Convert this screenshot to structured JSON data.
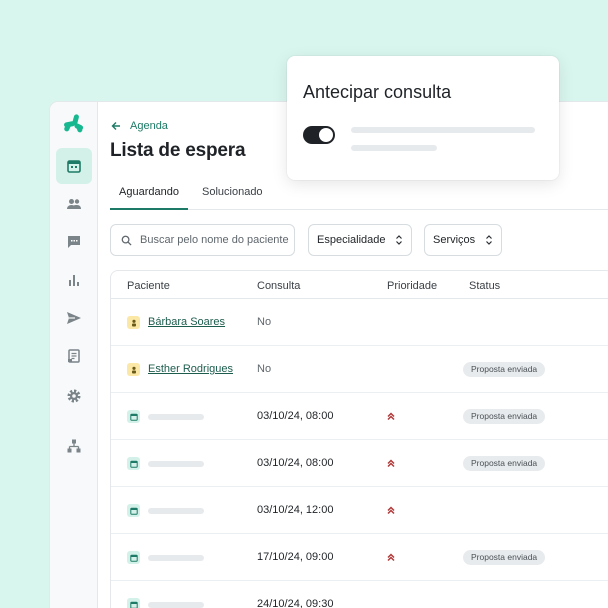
{
  "colors": {
    "accent": "#1d7a66",
    "background": "#d9f6ee",
    "priority": "#b23a3a"
  },
  "sidebar": {
    "logo_icon": "doctoralia-logo-icon",
    "items": [
      {
        "icon": "calendar-icon",
        "active": true
      },
      {
        "icon": "users-icon",
        "active": false
      },
      {
        "icon": "chat-icon",
        "active": false
      },
      {
        "icon": "bar-chart-icon",
        "active": false
      },
      {
        "icon": "send-icon",
        "active": false
      },
      {
        "icon": "document-icon",
        "active": false
      },
      {
        "icon": "gear-icon",
        "active": false
      },
      {
        "icon": "org-icon",
        "active": false
      }
    ]
  },
  "header": {
    "breadcrumb": "Agenda",
    "title": "Lista de espera"
  },
  "tabs": [
    {
      "label": "Aguardando",
      "active": true
    },
    {
      "label": "Solucionado",
      "active": false
    }
  ],
  "filters": {
    "search_placeholder": "Buscar pelo nome do paciente",
    "specialty": "Especialidade",
    "services": "Serviços"
  },
  "table": {
    "headers": {
      "patient": "Paciente",
      "consult": "Consulta",
      "priority": "Prioridade",
      "status": "Status"
    },
    "rows": [
      {
        "type": "person",
        "name": "Bárbara Soares",
        "consulta": "No",
        "priority": false,
        "status": ""
      },
      {
        "type": "person",
        "name": "Esther Rodrigues",
        "consulta": "No",
        "priority": false,
        "status": "Proposta enviada"
      },
      {
        "type": "calendar",
        "name": "",
        "consulta": "03/10/24, 08:00",
        "priority": true,
        "status": "Proposta enviada"
      },
      {
        "type": "calendar",
        "name": "",
        "consulta": "03/10/24, 08:00",
        "priority": true,
        "status": "Proposta enviada"
      },
      {
        "type": "calendar",
        "name": "",
        "consulta": "03/10/24, 12:00",
        "priority": true,
        "status": ""
      },
      {
        "type": "calendar",
        "name": "",
        "consulta": "17/10/24, 09:00",
        "priority": true,
        "status": "Proposta enviada"
      },
      {
        "type": "calendar",
        "name": "",
        "consulta": "24/10/24, 09:30",
        "priority": false,
        "status": ""
      }
    ]
  },
  "popup": {
    "title": "Antecipar consulta",
    "toggle_on": true
  }
}
